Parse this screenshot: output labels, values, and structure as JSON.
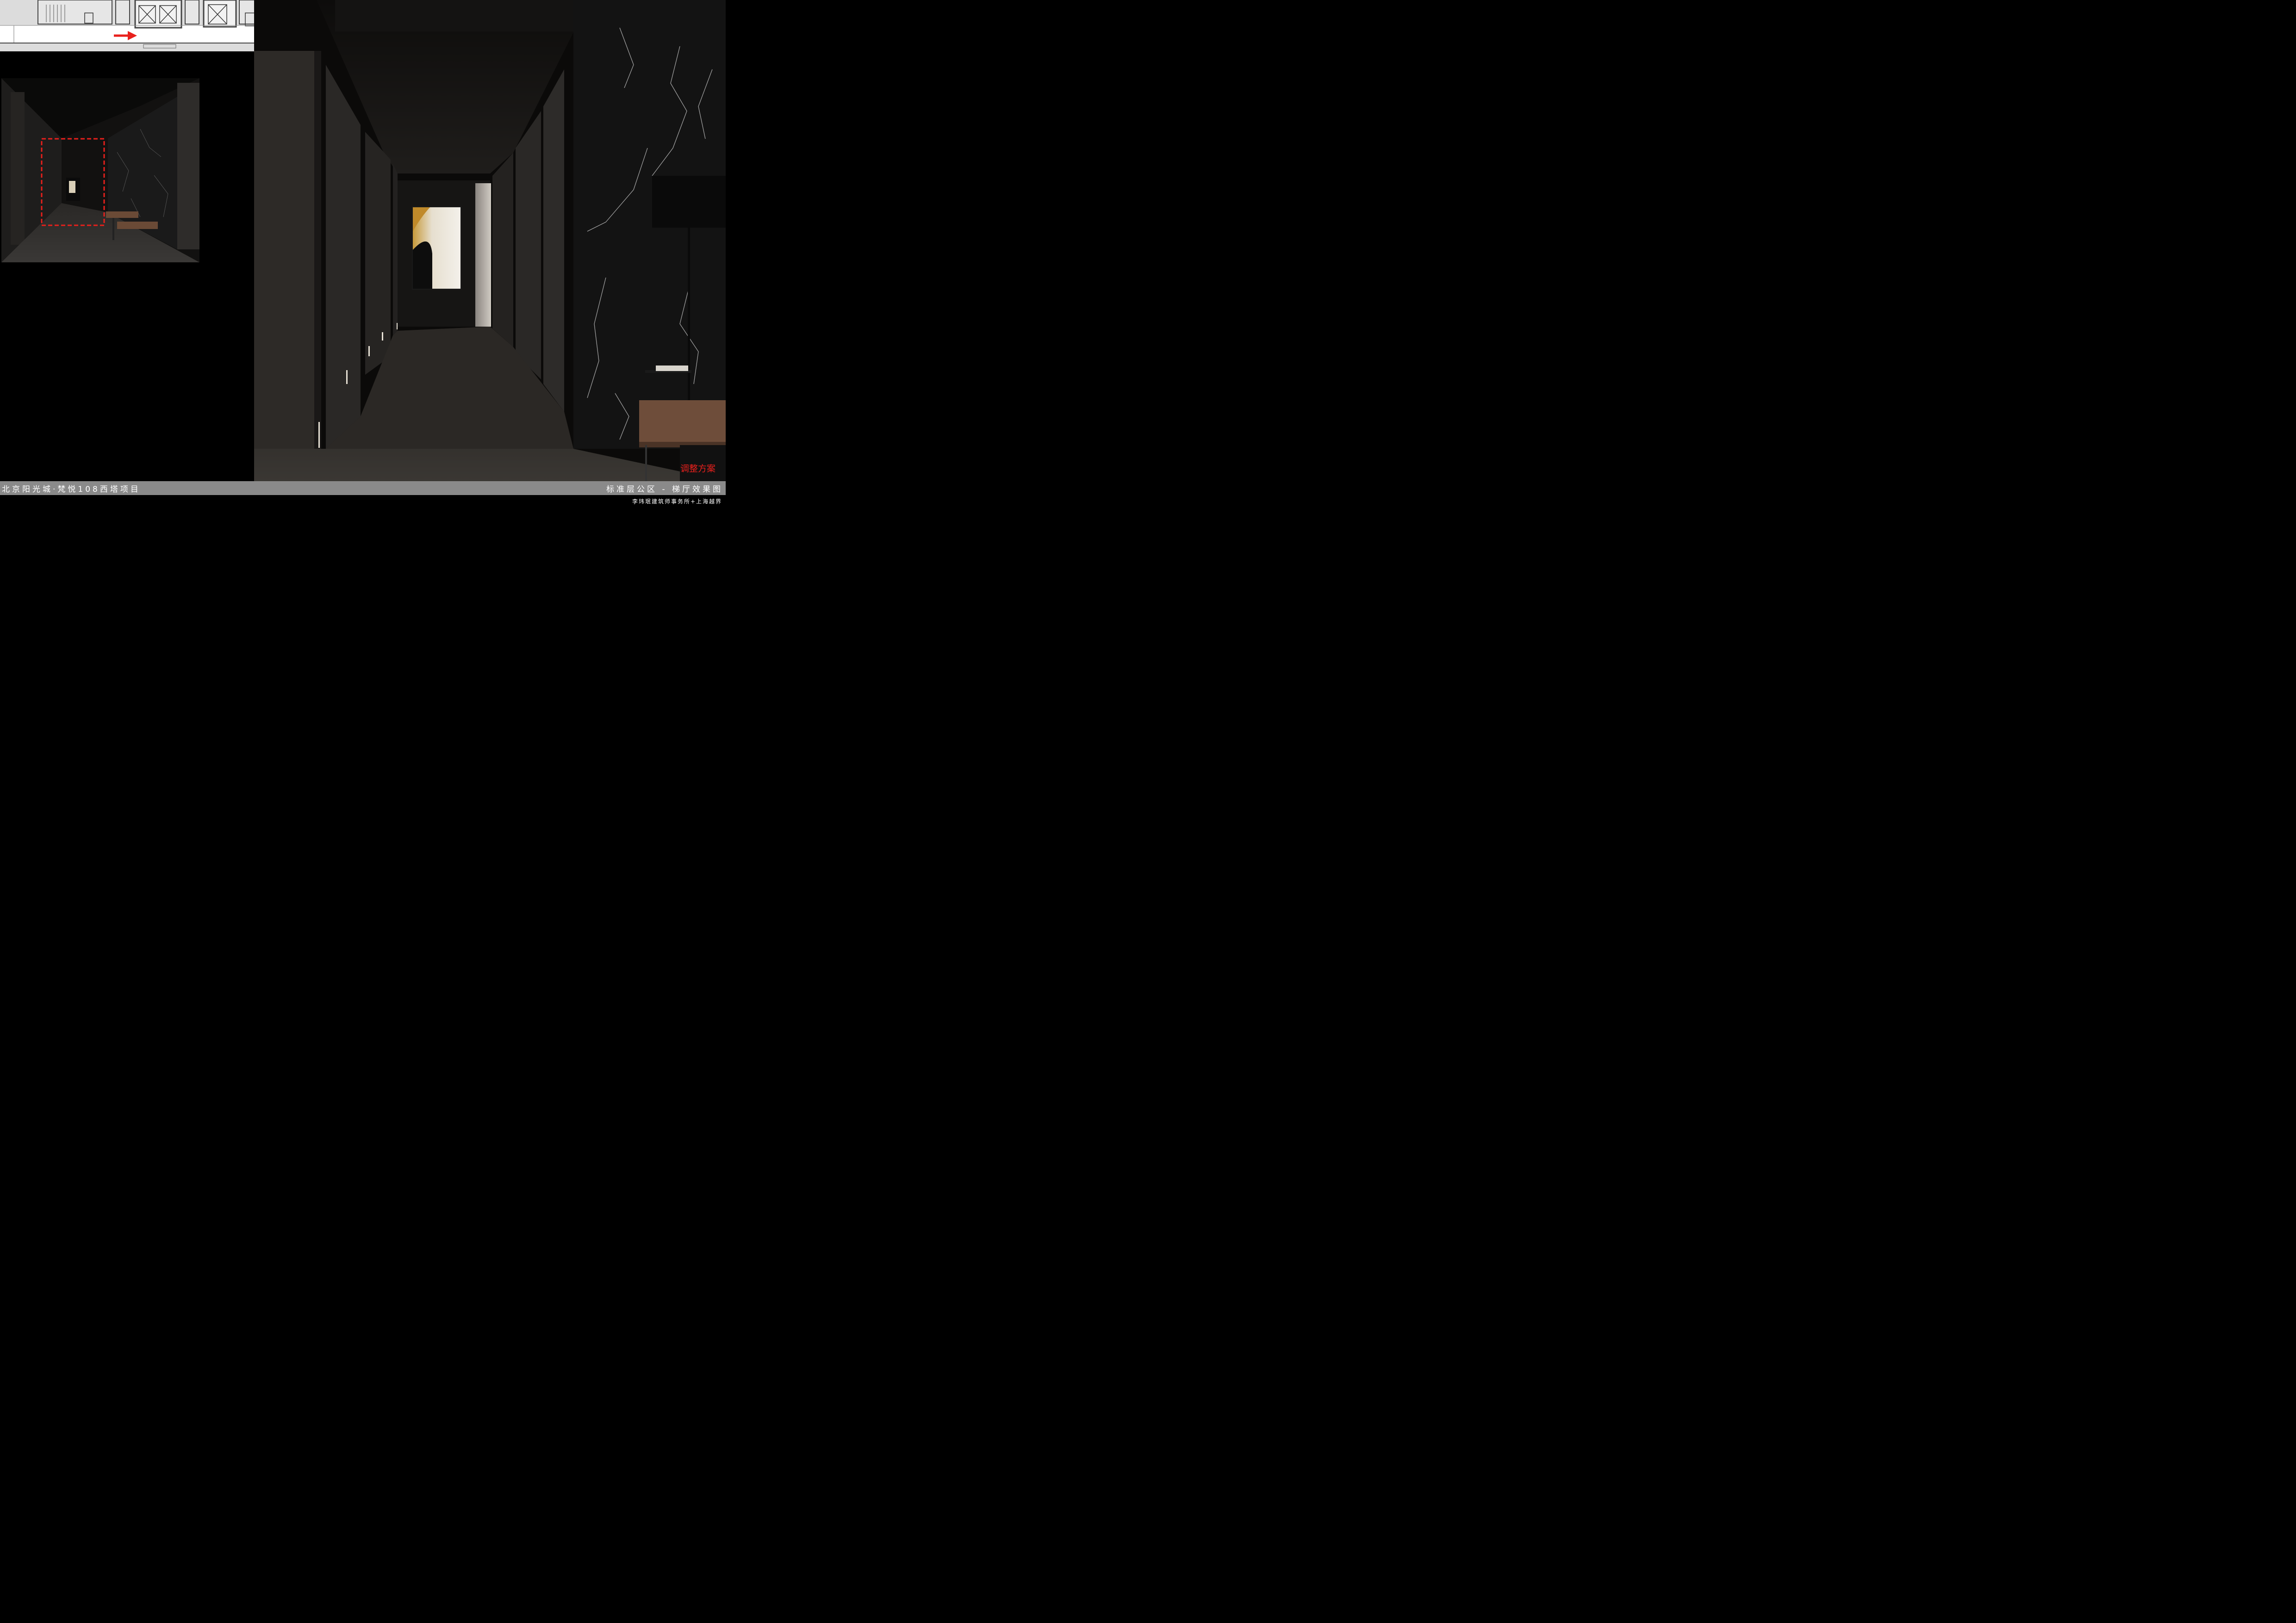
{
  "title_bar": {
    "project": "北京阳光城·梵悦108西塔项目",
    "drawing": "标准层公区 - 梯厅效果图"
  },
  "credit": "李玮珉建筑师事务所+上海越界",
  "revision_label": "调整方案",
  "colors": {
    "title_bar_bg": "#8a8a8a",
    "revision_text": "#e8201c",
    "indicator_red": "#e8201c"
  },
  "icons": {
    "plan_direction": "red-arrow-icon",
    "thumb_highlight": "dashed-rectangle-icon"
  }
}
